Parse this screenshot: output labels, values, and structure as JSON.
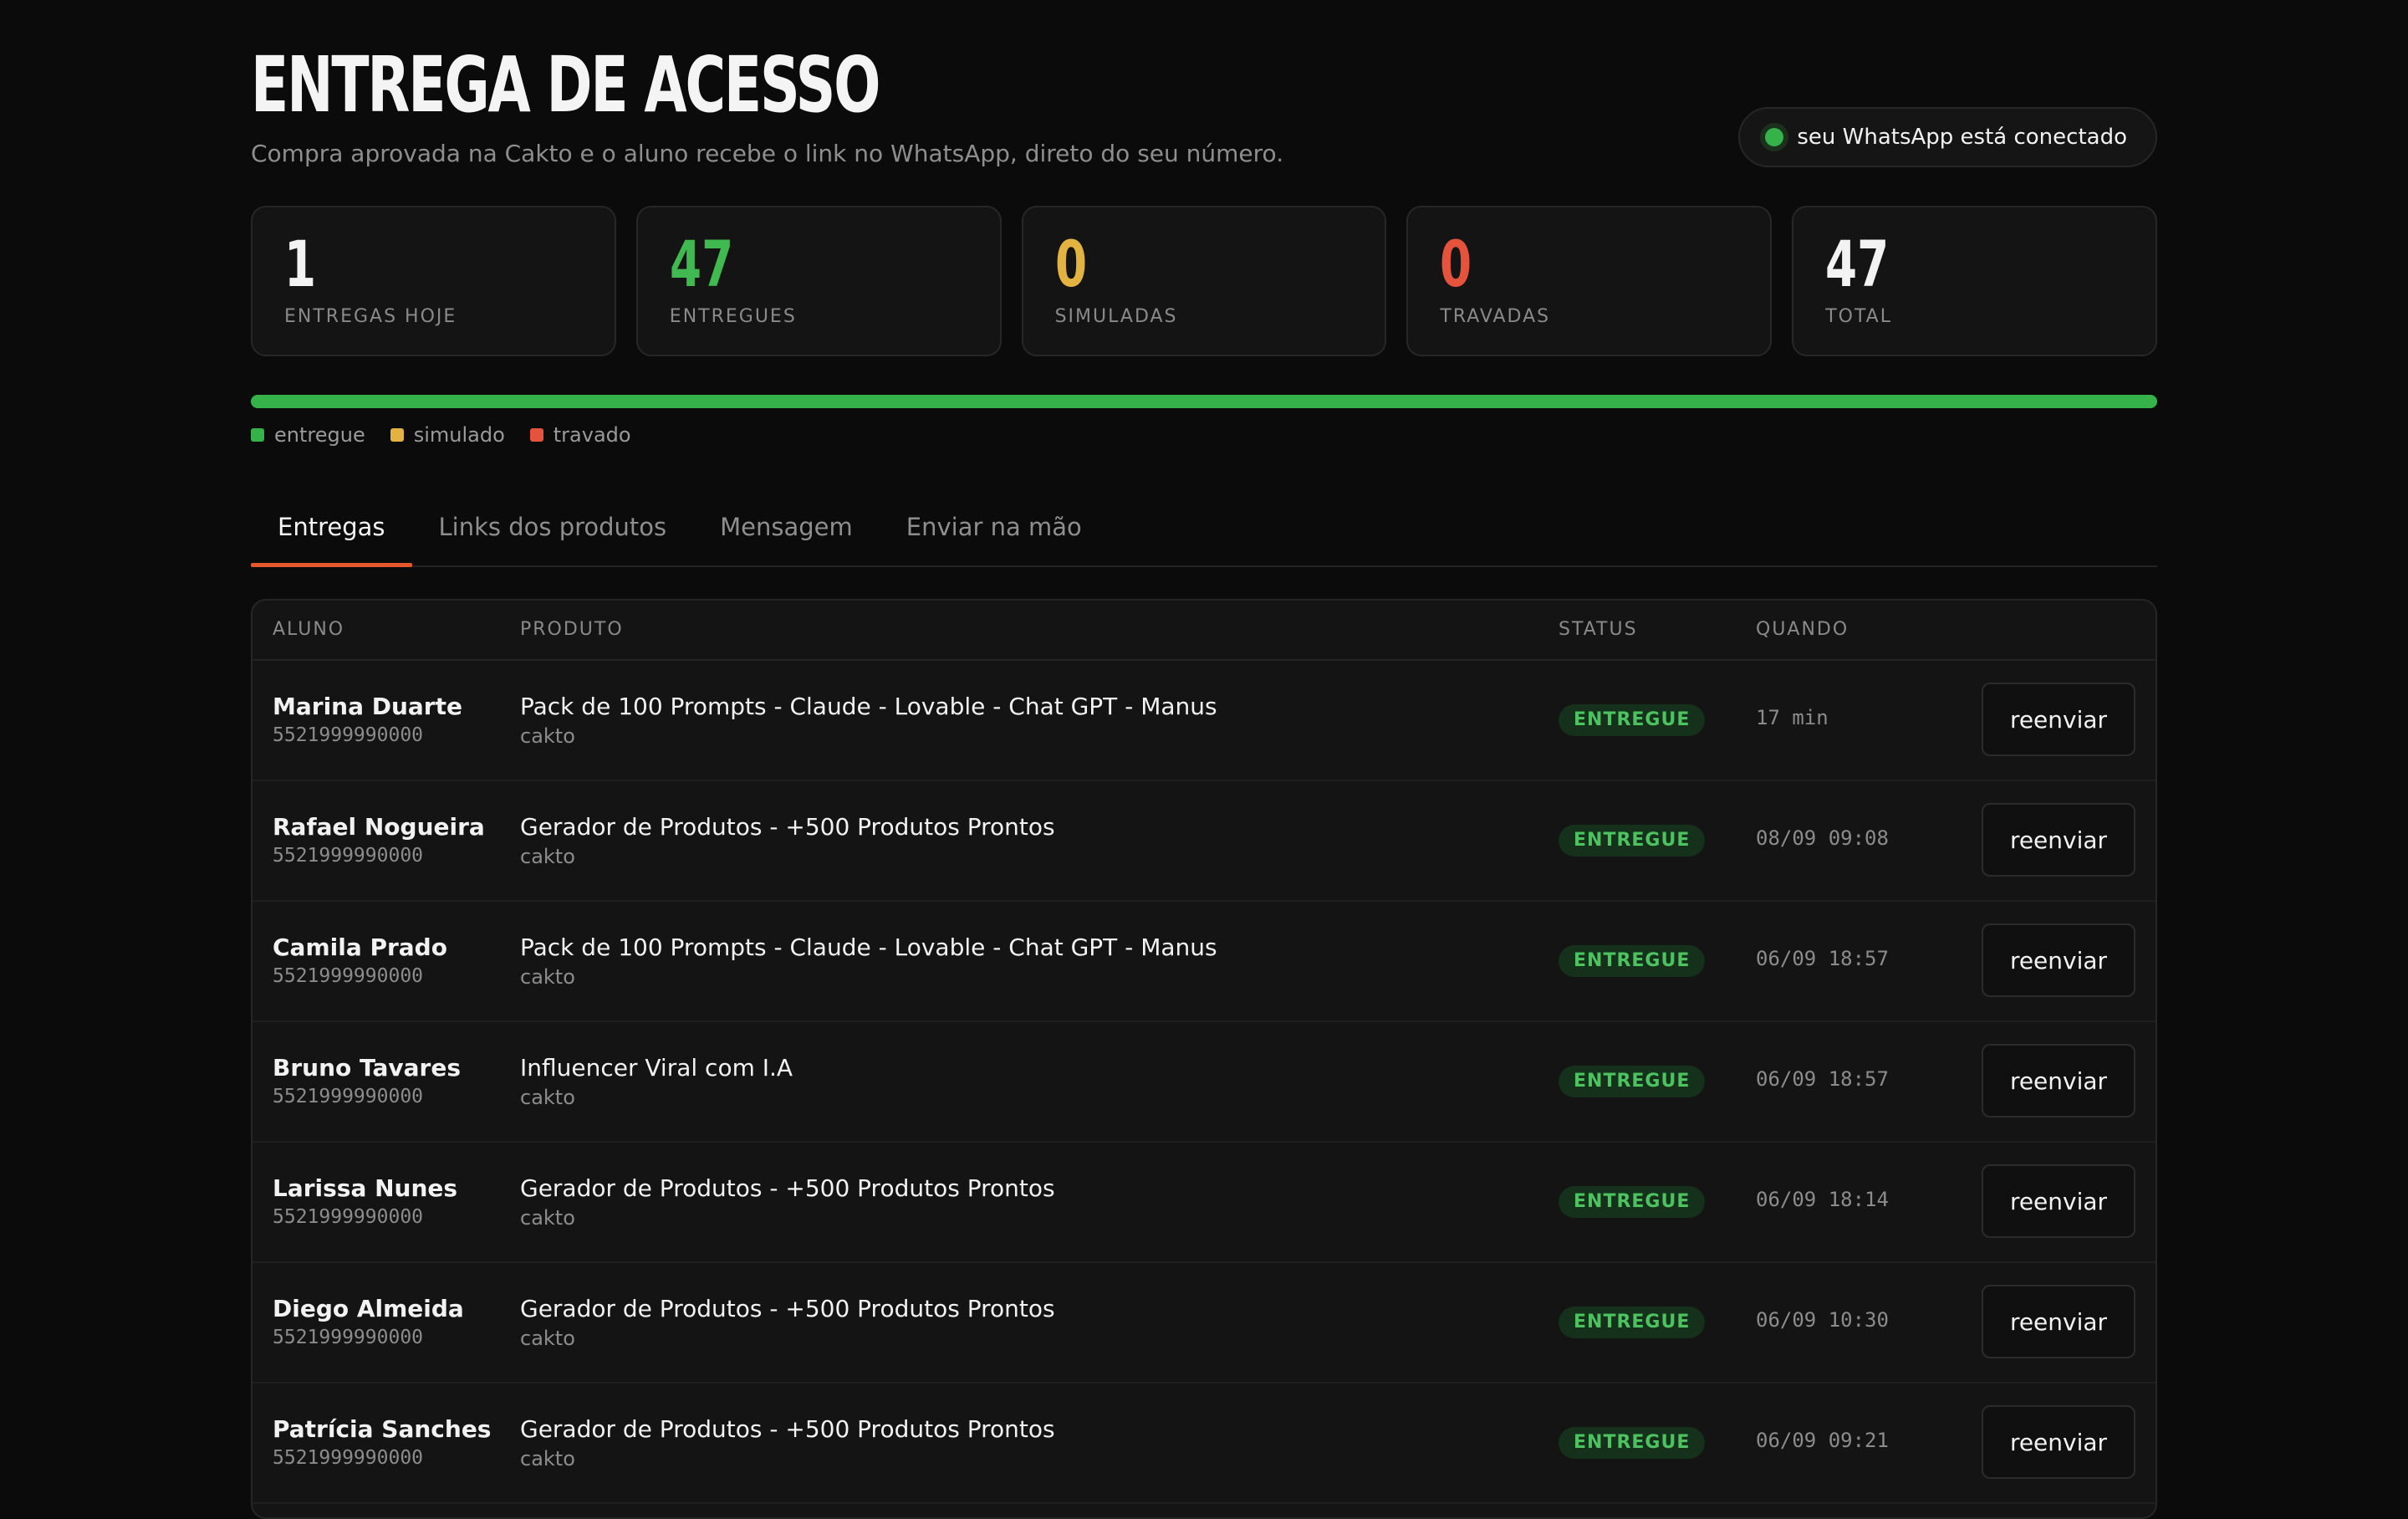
{
  "header": {
    "title": "ENTREGA DE ACESSO",
    "subtitle": "Compra aprovada na Cakto e o aluno recebe o link no WhatsApp, direto do seu número.",
    "whatsapp_status": "seu WhatsApp está conectado"
  },
  "stats": [
    {
      "value": "1",
      "label": "ENTREGAS HOJE",
      "color": "#f2f2f2"
    },
    {
      "value": "47",
      "label": "ENTREGUES",
      "color": "#3fb950"
    },
    {
      "value": "0",
      "label": "SIMULADAS",
      "color": "#e3b341"
    },
    {
      "value": "0",
      "label": "TRAVADAS",
      "color": "#e5533d"
    },
    {
      "value": "47",
      "label": "TOTAL",
      "color": "#f2f2f2"
    }
  ],
  "progress": {
    "entregue": 47,
    "simulado": 0,
    "travado": 0,
    "colors": {
      "entregue": "#36b24a",
      "simulado": "#e3b341",
      "travado": "#e5533d"
    }
  },
  "legend": {
    "entregue": "entregue",
    "simulado": "simulado",
    "travado": "travado"
  },
  "tabs": [
    {
      "label": "Entregas",
      "active": true
    },
    {
      "label": "Links dos produtos",
      "active": false
    },
    {
      "label": "Mensagem",
      "active": false
    },
    {
      "label": "Enviar na mão",
      "active": false
    }
  ],
  "table": {
    "headers": {
      "aluno": "ALUNO",
      "produto": "PRODUTO",
      "status": "STATUS",
      "quando": "QUANDO"
    },
    "rows": [
      {
        "name": "Marina Duarte",
        "phone": "5521999990000",
        "product": "Pack de 100 Prompts - Claude - Lovable - Chat GPT - Manus",
        "source": "cakto",
        "status": "ENTREGUE",
        "when": "17 min",
        "action": "reenviar"
      },
      {
        "name": "Rafael Nogueira",
        "phone": "5521999990000",
        "product": "Gerador de Produtos - +500 Produtos Prontos",
        "source": "cakto",
        "status": "ENTREGUE",
        "when": "08/09 09:08",
        "action": "reenviar"
      },
      {
        "name": "Camila Prado",
        "phone": "5521999990000",
        "product": "Pack de 100 Prompts - Claude - Lovable - Chat GPT - Manus",
        "source": "cakto",
        "status": "ENTREGUE",
        "when": "06/09 18:57",
        "action": "reenviar"
      },
      {
        "name": "Bruno Tavares",
        "phone": "5521999990000",
        "product": "Influencer Viral com I.A",
        "source": "cakto",
        "status": "ENTREGUE",
        "when": "06/09 18:57",
        "action": "reenviar"
      },
      {
        "name": "Larissa Nunes",
        "phone": "5521999990000",
        "product": "Gerador de Produtos - +500 Produtos Prontos",
        "source": "cakto",
        "status": "ENTREGUE",
        "when": "06/09 18:14",
        "action": "reenviar"
      },
      {
        "name": "Diego Almeida",
        "phone": "5521999990000",
        "product": "Gerador de Produtos - +500 Produtos Prontos",
        "source": "cakto",
        "status": "ENTREGUE",
        "when": "06/09 10:30",
        "action": "reenviar"
      },
      {
        "name": "Patrícia Sanches",
        "phone": "5521999990000",
        "product": "Gerador de Produtos - +500 Produtos Prontos",
        "source": "cakto",
        "status": "ENTREGUE",
        "when": "06/09 09:21",
        "action": "reenviar"
      }
    ]
  }
}
